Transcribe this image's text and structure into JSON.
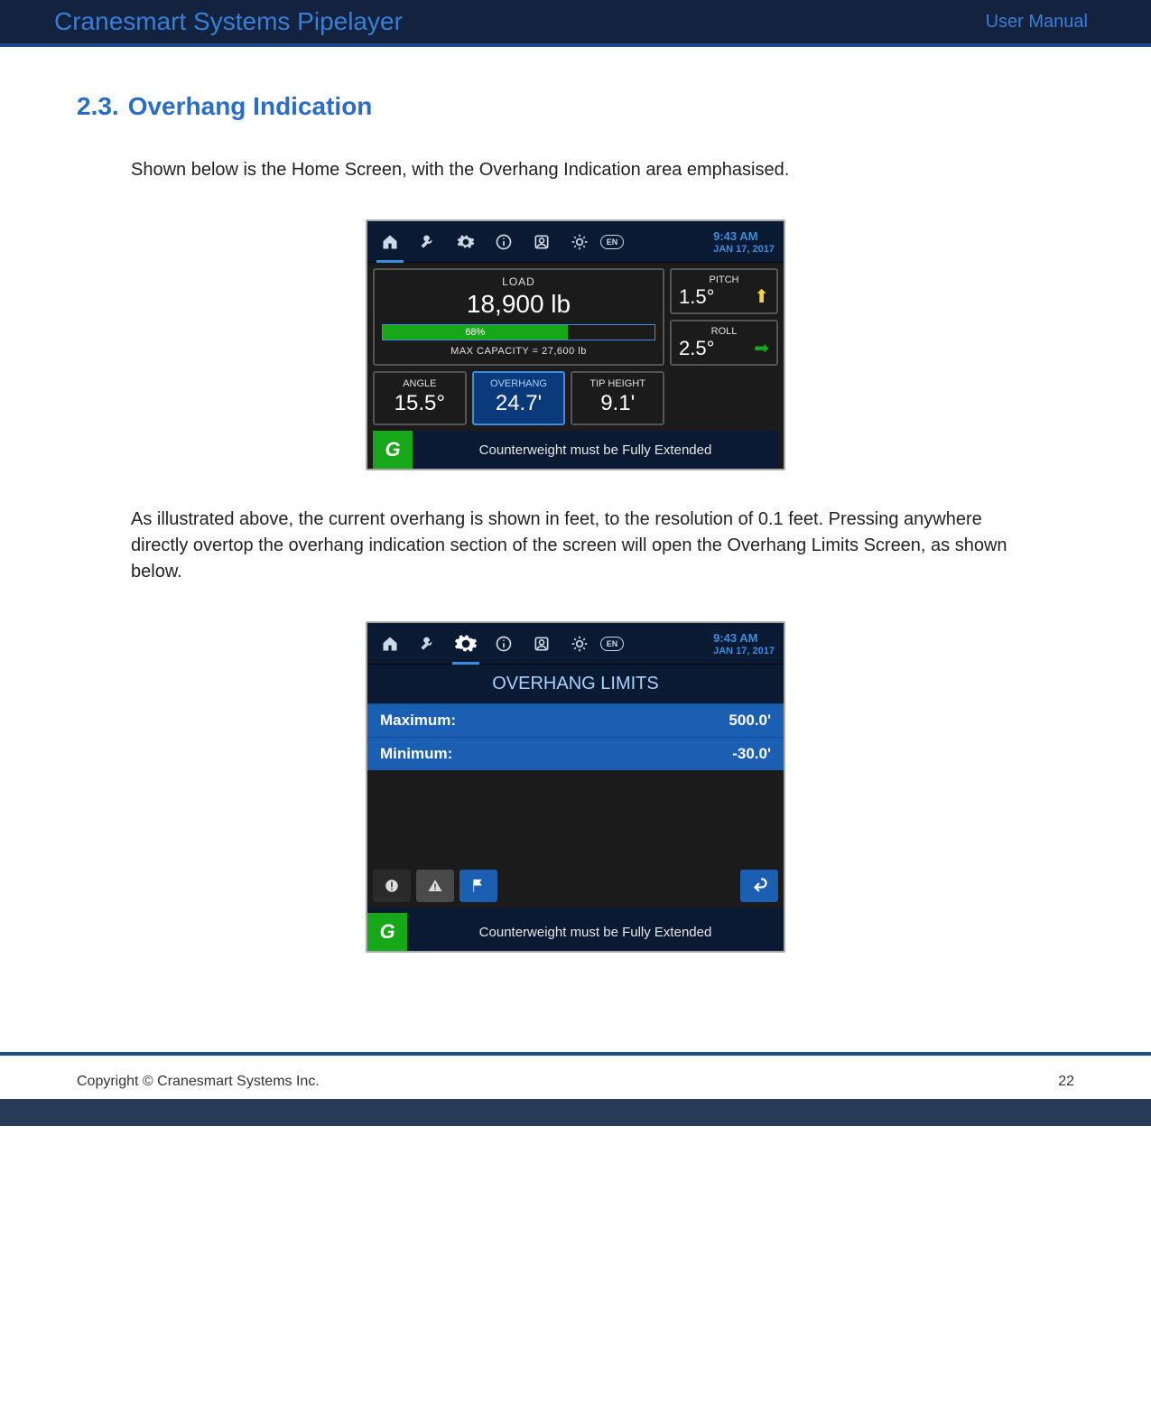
{
  "header": {
    "title": "Cranesmart Systems Pipelayer",
    "subtitle": "User Manual"
  },
  "section": {
    "number": "2.3.",
    "title": "Overhang Indication"
  },
  "para1": "Shown below is the Home Screen, with the Overhang Indication area emphasised.",
  "para2": "As illustrated above, the current overhang is shown in feet, to the resolution of 0.1 feet. Pressing anywhere directly overtop the overhang indication section of the screen will open the Overhang Limits Screen, as shown below.",
  "topbar": {
    "time": "9:43 AM",
    "date": "JAN 17, 2017",
    "lang": "EN"
  },
  "home": {
    "load_label": "LOAD",
    "load_value": "18,900 lb",
    "load_percent": "68%",
    "max_capacity": "MAX CAPACITY = 27,600 lb",
    "pitch_label": "PITCH",
    "pitch_value": "1.5°",
    "roll_label": "ROLL",
    "roll_value": "2.5°",
    "angle_label": "ANGLE",
    "angle_value": "15.5°",
    "overhang_label": "OVERHANG",
    "overhang_value": "24.7'",
    "tip_label": "TIP HEIGHT",
    "tip_value": "9.1'",
    "cw_icon": "G",
    "cw_text": "Counterweight must be Fully Extended"
  },
  "limits": {
    "title": "OVERHANG LIMITS",
    "max_label": "Maximum:",
    "max_value": "500.0'",
    "min_label": "Minimum:",
    "min_value": "-30.0'"
  },
  "footer": {
    "copyright": "Copyright © Cranesmart Systems Inc.",
    "page": "22"
  }
}
